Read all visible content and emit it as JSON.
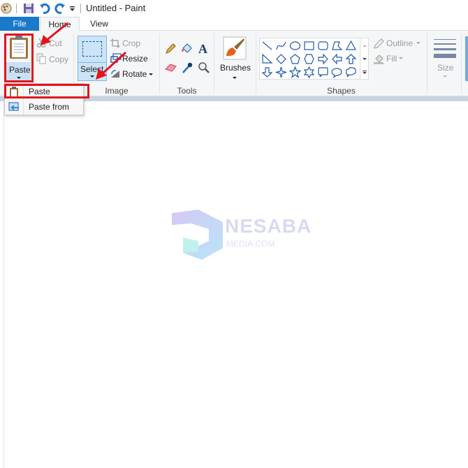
{
  "title_bar": {
    "title": "Untitled - Paint",
    "icons": [
      "paint-app-icon",
      "save-icon",
      "undo-icon",
      "redo-icon",
      "customize-quick-access-icon"
    ]
  },
  "tabs": [
    {
      "label": "File",
      "active": false,
      "color": "#1979ca"
    },
    {
      "label": "Home",
      "active": true
    },
    {
      "label": "View",
      "active": false
    }
  ],
  "clipboard": {
    "paste": "Paste",
    "cut": "Cut",
    "copy": "Copy"
  },
  "image": {
    "select": "Select",
    "crop": "Crop",
    "resize": "Resize",
    "rotate": "Rotate",
    "group_label": "Image"
  },
  "tools": {
    "group_label": "Tools",
    "items": [
      "pencil",
      "fill",
      "text",
      "eraser",
      "color-picker",
      "magnifier"
    ]
  },
  "brushes": {
    "label": "Brushes"
  },
  "shapes": {
    "group_label": "Shapes",
    "outline": "Outline",
    "fill": "Fill",
    "items": [
      "line",
      "curve",
      "oval",
      "rectangle",
      "rounded-rectangle",
      "polygon",
      "triangle",
      "right-triangle",
      "diamond",
      "pentagon",
      "hexagon",
      "right-arrow",
      "left-arrow",
      "up-arrow",
      "down-arrow",
      "four-point-star",
      "five-point-star",
      "six-point-star",
      "rounded-rectangular-callout",
      "oval-callout",
      "cloud-callout"
    ]
  },
  "size": {
    "label": "Size"
  },
  "paste_menu": {
    "items": [
      {
        "label": "Paste",
        "icon": "clipboard-icon"
      },
      {
        "label": "Paste from",
        "icon": "paste-from-icon"
      }
    ]
  },
  "watermark": {
    "title": "NESABA",
    "subtitle": "MEDIA.COM"
  },
  "annotation_color": "#e3141b"
}
